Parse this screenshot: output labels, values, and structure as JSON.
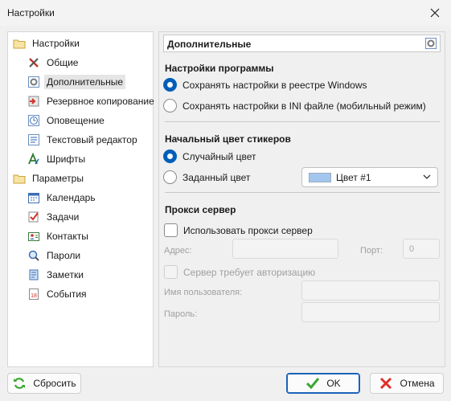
{
  "window": {
    "title": "Настройки"
  },
  "tree": {
    "items": [
      {
        "label": "Настройки",
        "icon": "folder-icon"
      },
      {
        "label": "Общие",
        "icon": "tools-icon"
      },
      {
        "label": "Дополнительные",
        "icon": "settings-icon"
      },
      {
        "label": "Резервное копирование",
        "icon": "backup-icon"
      },
      {
        "label": "Оповещение",
        "icon": "clock-icon"
      },
      {
        "label": "Текстовый редактор",
        "icon": "text-editor-icon"
      },
      {
        "label": "Шрифты",
        "icon": "font-icon"
      },
      {
        "label": "Параметры",
        "icon": "folder-icon"
      },
      {
        "label": "Календарь",
        "icon": "calendar-icon"
      },
      {
        "label": "Задачи",
        "icon": "tasks-icon"
      },
      {
        "label": "Контакты",
        "icon": "contacts-icon"
      },
      {
        "label": "Пароли",
        "icon": "passwords-icon"
      },
      {
        "label": "Заметки",
        "icon": "notes-icon"
      },
      {
        "label": "События",
        "icon": "events-icon"
      }
    ],
    "selected": "Дополнительные"
  },
  "panel": {
    "title": "Дополнительные",
    "program_settings": {
      "title": "Настройки программы",
      "option_registry": "Сохранять настройки в реестре Windows",
      "option_ini": "Сохранять настройки в INI файле (мобильный режим)",
      "selected": "registry"
    },
    "sticker_color": {
      "title": "Начальный цвет стикеров",
      "option_random": "Случайный цвет",
      "option_fixed": "Заданный цвет",
      "selected": "random",
      "color_value": "Цвет #1",
      "color_hex": "#a3c6ee"
    },
    "proxy": {
      "title": "Прокси сервер",
      "use_proxy_label": "Использовать прокси сервер",
      "use_proxy_checked": false,
      "address_label": "Адрес:",
      "address_value": "",
      "port_label": "Порт:",
      "port_value": "0",
      "auth_label": "Сервер требует авторизацию",
      "auth_checked": false,
      "username_label": "Имя пользователя:",
      "username_value": "",
      "password_label": "Пароль:",
      "password_value": ""
    }
  },
  "buttons": {
    "reset": "Сбросить",
    "ok": "OK",
    "cancel": "Отмена"
  },
  "colors": {
    "accent": "#005fb8",
    "ok_icon": "#3aa832",
    "cancel_icon": "#e0302a"
  }
}
